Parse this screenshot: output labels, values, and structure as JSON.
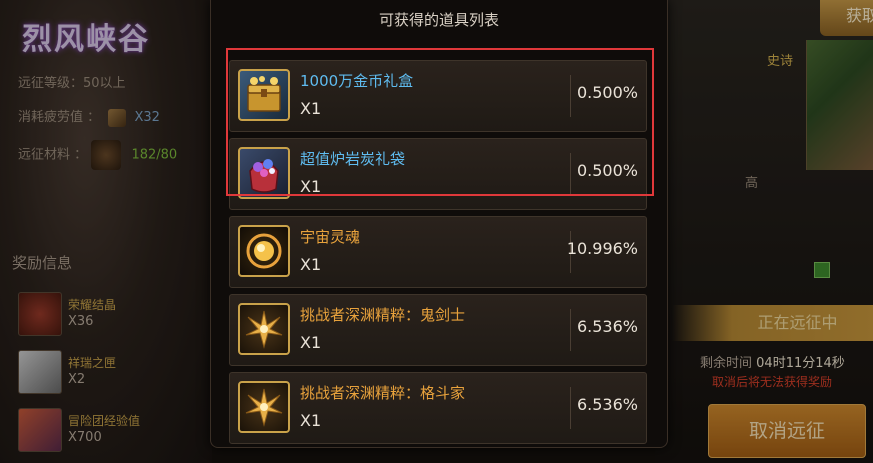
{
  "background": {
    "valley_title": "烈风峡谷",
    "level_label": "远征等级：",
    "level_value": "50以上",
    "fatigue_label": "消耗疲劳值",
    "fatigue_sep": "：",
    "fatigue_value": "X32",
    "material_label": "远征材料",
    "material_sep": "：",
    "material_value": "182/80",
    "reward_header": "奖励信息",
    "rewards": [
      {
        "name": "荣耀结晶",
        "count": "X36"
      },
      {
        "name": "祥瑞之匣",
        "count": "X2"
      },
      {
        "name": "冒险团经验值",
        "count": "X700"
      }
    ],
    "get_button": "获取",
    "map_label": "史诗",
    "right_text": "高",
    "status": "正在远征中",
    "remaining_label": "剩余时间",
    "remaining_time": "04时11分14秒",
    "warning": "取消后将无法获得奖励",
    "cancel_button": "取消远征"
  },
  "popup": {
    "title": "可获得的道具列表",
    "items": [
      {
        "name": "1000万金币礼盒",
        "qty": "X1",
        "percent": "0.500%",
        "name_color": "blue",
        "icon": "gold-chest-icon"
      },
      {
        "name": "超值炉岩炭礼袋",
        "qty": "X1",
        "percent": "0.500%",
        "name_color": "blue",
        "icon": "gem-bag-icon"
      },
      {
        "name": "宇宙灵魂",
        "qty": "X1",
        "percent": "10.996%",
        "name_color": "orange",
        "icon": "cosmic-soul-icon"
      },
      {
        "name": "挑战者深渊精粹：鬼剑士",
        "qty": "X1",
        "percent": "6.536%",
        "name_color": "orange",
        "icon": "abyss-essence-icon"
      },
      {
        "name": "挑战者深渊精粹：格斗家",
        "qty": "X1",
        "percent": "6.536%",
        "name_color": "orange",
        "icon": "abyss-essence-icon"
      }
    ]
  },
  "colors": {
    "blue_name": "#5fbcf0",
    "orange_name": "#e8a23c",
    "highlight": "#e0383a",
    "icon_border": "#c9a24a"
  }
}
